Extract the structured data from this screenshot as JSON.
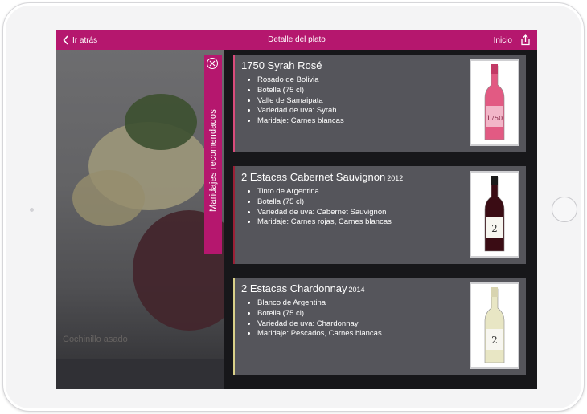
{
  "app": {
    "nav": {
      "back_label": "Ir atrás",
      "title": "Detalle del plato",
      "home_label": "Inicio"
    },
    "dish": {
      "name": "Cochinillo asado"
    },
    "pairing_tab": {
      "label": "Maridajes recomendados"
    },
    "wines": [
      {
        "name": "1750 Syrah Rosé",
        "year": "",
        "details": [
          "Rosado de Bolivia",
          "Botella (75 cl)",
          "Valle de Samaipata",
          "Variedad de uva: Syrah",
          "Maridaje: Carnes blancas"
        ],
        "accent_color": "#d94b7b",
        "bottle_label": "1750",
        "wine_color": "#e25a83"
      },
      {
        "name": "2 Estacas Cabernet Sauvignon",
        "year": "2012",
        "details": [
          "Tinto de Argentina",
          "Botella (75 cl)",
          "Variedad de uva: Cabernet Sauvignon",
          "Maridaje: Carnes rojas, Carnes blancas"
        ],
        "accent_color": "#9b2036",
        "bottle_label": "2",
        "wine_color": "#3a0c14"
      },
      {
        "name": "2 Estacas Chardonnay",
        "year": "2014",
        "details": [
          "Blanco de Argentina",
          "Botella (75 cl)",
          "Variedad de uva: Chardonnay",
          "Maridaje: Pescados, Carnes blancas"
        ],
        "accent_color": "#d9d089",
        "bottle_label": "2",
        "wine_color": "#e8e6c4"
      }
    ],
    "colors": {
      "brand": "#b5176e"
    }
  }
}
